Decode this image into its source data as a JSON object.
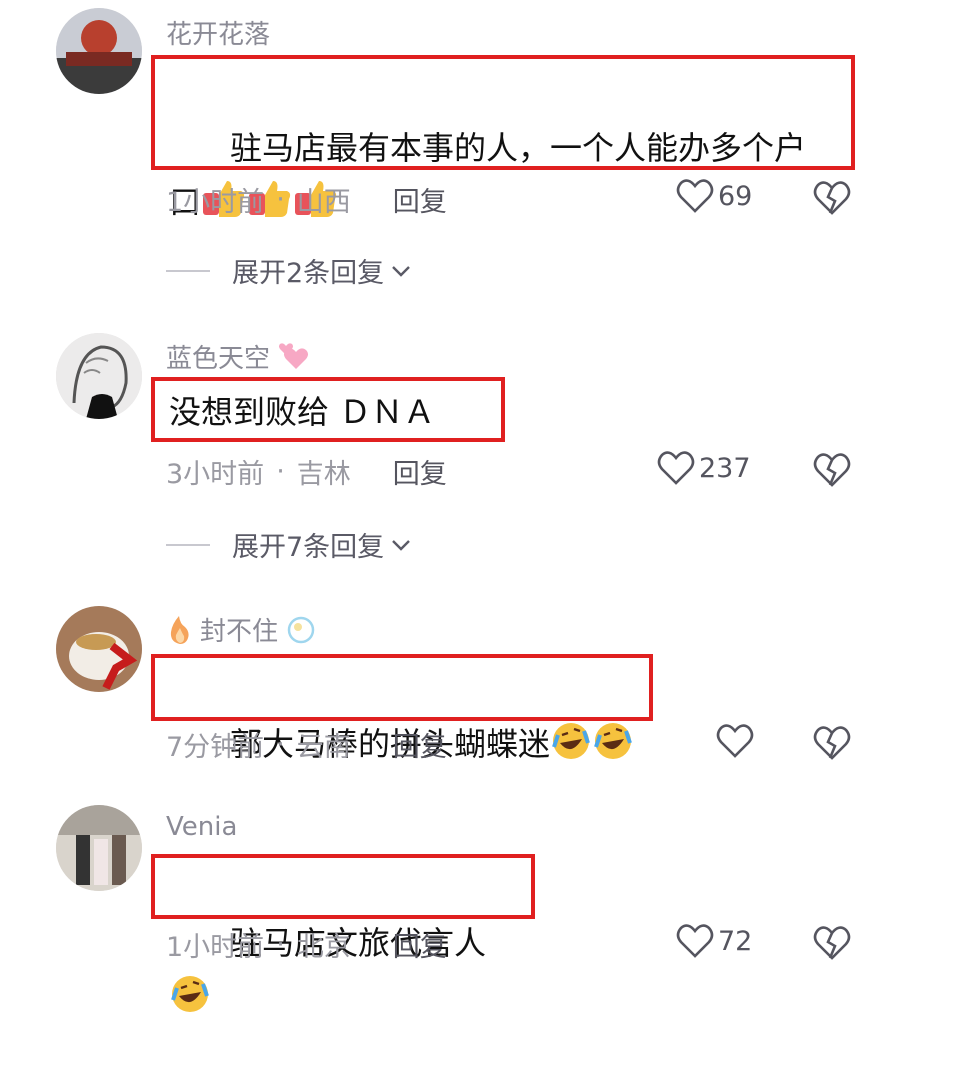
{
  "comments": [
    {
      "username": "花开花落",
      "text": "驻马店最有本事的人，一个人能办多个户\n口",
      "emoji": [
        "thumbs-up",
        "thumbs-up",
        "thumbs-up"
      ],
      "time": "1小时前",
      "location": "山西",
      "reply_label": "回复",
      "likes": "69",
      "expand_label": "展开2条回复"
    },
    {
      "username": "蓝色天空",
      "username_emoji": "hearts",
      "text": "没想到败给 ＤＮＡ",
      "time": "3小时前",
      "location": "吉林",
      "reply_label": "回复",
      "likes": "237",
      "expand_label": "展开7条回复"
    },
    {
      "username": "封不住",
      "username_emoji_left": "fire",
      "username_emoji_right": "bubble",
      "text": "郭大马棒的拼头蝴蝶迷",
      "emoji": [
        "rofl",
        "rofl"
      ],
      "time": "7分钟前",
      "location": "云南",
      "reply_label": "回复",
      "likes": ""
    },
    {
      "username": "Venia",
      "text": "驻马店文旅代言人",
      "emoji": [
        "rofl"
      ],
      "time": "1小时前",
      "location": "北京",
      "reply_label": "回复",
      "likes": "72"
    }
  ],
  "colors": {
    "highlight_border": "#e02020",
    "meta": "#9a9aa2",
    "username": "#8a8a95"
  }
}
